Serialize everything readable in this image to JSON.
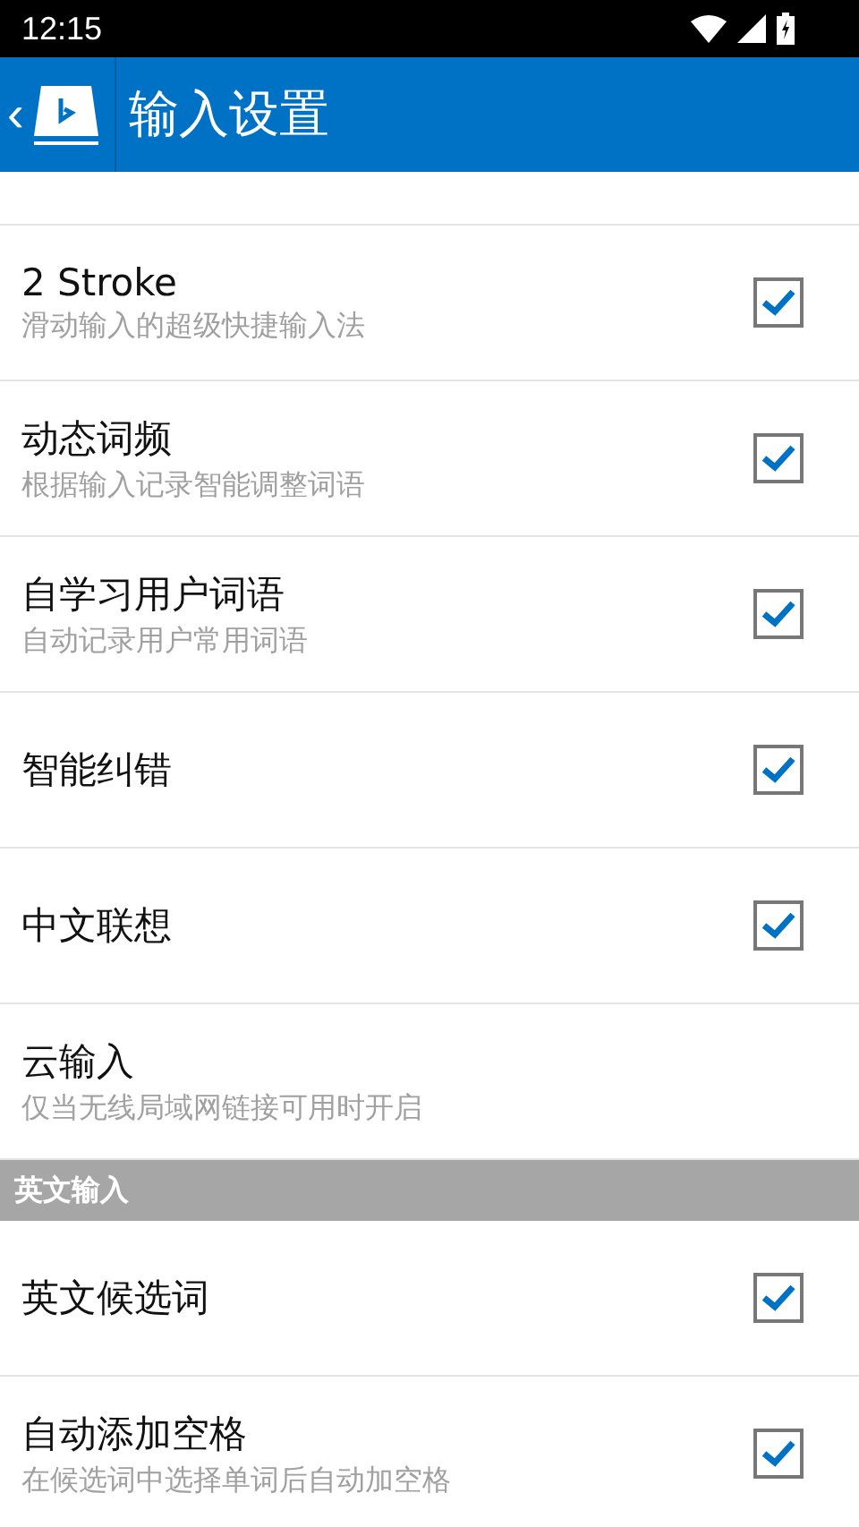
{
  "status_bar": {
    "time": "12:15"
  },
  "header": {
    "back": "‹",
    "title": "输入设置"
  },
  "sections": [
    {
      "items": [
        {
          "kind": "check",
          "title": "2 Stroke",
          "subtitle": "滑动输入的超级快捷输入法",
          "checked": true
        },
        {
          "kind": "check",
          "title": "动态词频",
          "subtitle": "根据输入记录智能调整词语",
          "checked": true
        },
        {
          "kind": "check",
          "title": "自学习用户词语",
          "subtitle": "自动记录用户常用词语",
          "checked": true
        },
        {
          "kind": "check",
          "title": "智能纠错",
          "checked": true
        },
        {
          "kind": "check",
          "title": "中文联想",
          "checked": true
        },
        {
          "kind": "plain",
          "title": "云输入",
          "subtitle": "仅当无线局域网链接可用时开启"
        }
      ]
    },
    {
      "title": "英文输入",
      "items": [
        {
          "kind": "check",
          "title": "英文候选词",
          "checked": true
        },
        {
          "kind": "check",
          "title": "自动添加空格",
          "subtitle": "在候选词中选择单词后自动加空格",
          "checked": true
        }
      ]
    }
  ]
}
